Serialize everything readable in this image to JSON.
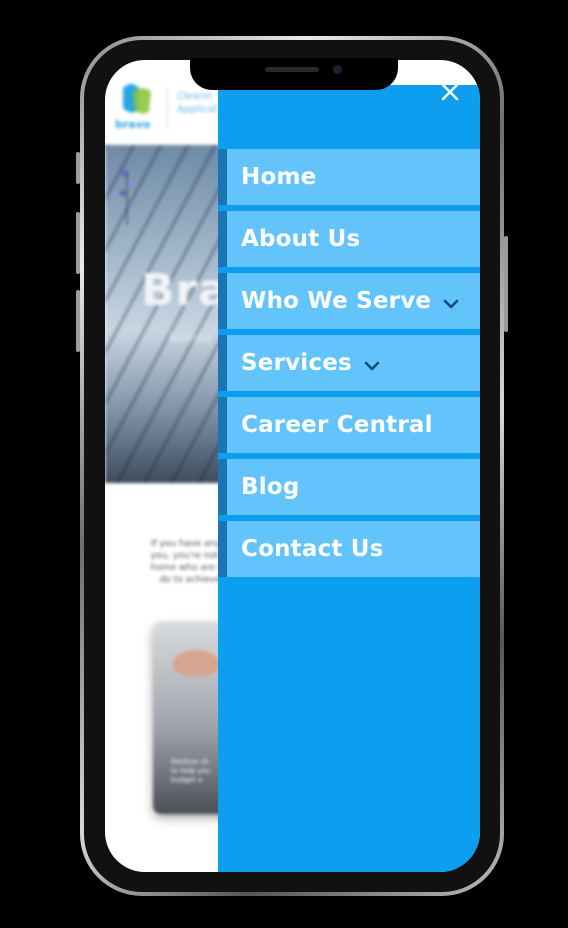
{
  "site": {
    "logo_text": "bravo",
    "tagline_lines": [
      "Clearin",
      "Applicat"
    ],
    "hero_title": "Bra",
    "hero_subtitle": "Numbe",
    "intro_lines": [
      "If you have any q",
      "you, you're not al",
      "home who are un",
      "do to achieve"
    ],
    "card_lines": [
      "Positive ch",
      "to help you",
      "budget a"
    ]
  },
  "menu": {
    "close_icon": "close-icon",
    "items": [
      {
        "label": "Home",
        "has_submenu": false
      },
      {
        "label": "About Us",
        "has_submenu": false
      },
      {
        "label": "Who We Serve",
        "has_submenu": true
      },
      {
        "label": "Services",
        "has_submenu": true
      },
      {
        "label": "Career Central",
        "has_submenu": false
      },
      {
        "label": "Blog",
        "has_submenu": false
      },
      {
        "label": "Contact Us",
        "has_submenu": false
      }
    ]
  },
  "colors": {
    "drawer": "#0d9ef0",
    "item": "#63c3fb",
    "item_edge": "#1a75b4",
    "chevron": "#0f4a78"
  }
}
